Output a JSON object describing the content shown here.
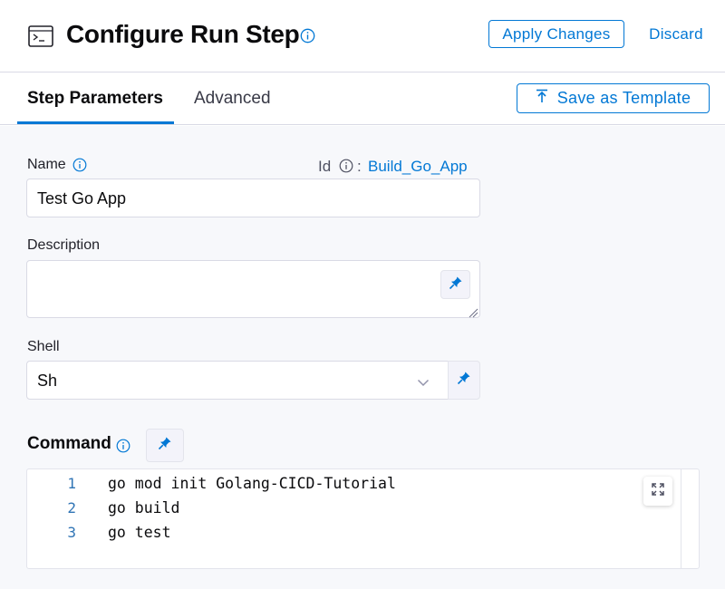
{
  "header": {
    "title": "Configure Run Step",
    "apply_label": "Apply Changes",
    "discard_label": "Discard"
  },
  "tabs": {
    "items": [
      {
        "label": "Step Parameters",
        "active": true
      },
      {
        "label": "Advanced",
        "active": false
      }
    ],
    "save_template_label": "Save as Template"
  },
  "form": {
    "name": {
      "label": "Name",
      "value": "Test Go App",
      "id_label": "Id",
      "id_separator": ":",
      "id_value": "Build_Go_App"
    },
    "description": {
      "label": "Description",
      "value": ""
    },
    "shell": {
      "label": "Shell",
      "value": "Sh"
    },
    "command": {
      "label": "Command",
      "lines": [
        {
          "num": "1",
          "code": "go mod init Golang-CICD-Tutorial"
        },
        {
          "num": "2",
          "code": "go build"
        },
        {
          "num": "3",
          "code": "go test"
        }
      ]
    }
  },
  "colors": {
    "accent": "#0278d5",
    "background": "#f7f8fb",
    "border": "#d9dae5"
  },
  "icons": {
    "header": "terminal-icon",
    "info": "info-icon",
    "pin": "pin-icon",
    "chevron": "chevron-down-icon",
    "upload": "upload-icon",
    "expand": "expand-icon"
  }
}
